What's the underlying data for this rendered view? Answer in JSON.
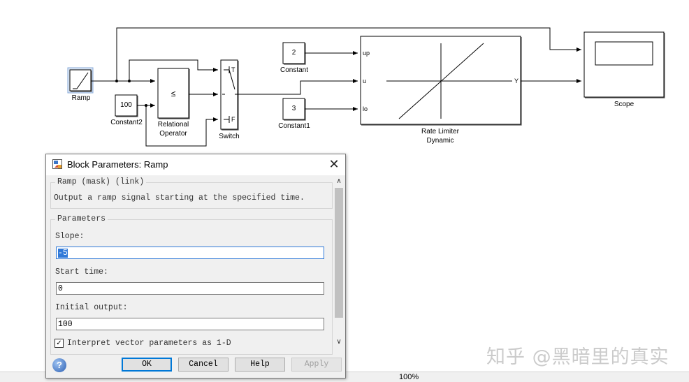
{
  "diagram": {
    "ramp_label": "Ramp",
    "constant2_value": "100",
    "constant2_label": "Constant2",
    "relop_symbol": "≤",
    "relop_label_1": "Relational",
    "relop_label_2": "Operator",
    "switch_label": "Switch",
    "switch_port_t": "T",
    "switch_port_f": "F",
    "constant_value": "2",
    "constant_label": "Constant",
    "constant1_value": "3",
    "constant1_label": "Constant1",
    "rld_port_up": "up",
    "rld_port_u": "u",
    "rld_port_lo": "lo",
    "rld_port_y": "Y",
    "rld_label_1": "Rate Limiter",
    "rld_label_2": "Dynamic",
    "scope_label": "Scope"
  },
  "dialog": {
    "title": "Block Parameters: Ramp",
    "mask_group_title": "Ramp (mask) (link)",
    "description": "Output a ramp signal starting at the specified time.",
    "params_group_title": "Parameters",
    "slope_label": "Slope:",
    "slope_value": "-5",
    "start_time_label": "Start time:",
    "start_time_value": "0",
    "initial_output_label": "Initial output:",
    "initial_output_value": "100",
    "interpret_label": "Interpret vector parameters as 1-D",
    "interpret_checked": true,
    "ok_label": "OK",
    "cancel_label": "Cancel",
    "help_label": "Help",
    "apply_label": "Apply"
  },
  "statusbar": {
    "zoom": "100%"
  },
  "watermark": "知乎 @黑暗里的真实"
}
